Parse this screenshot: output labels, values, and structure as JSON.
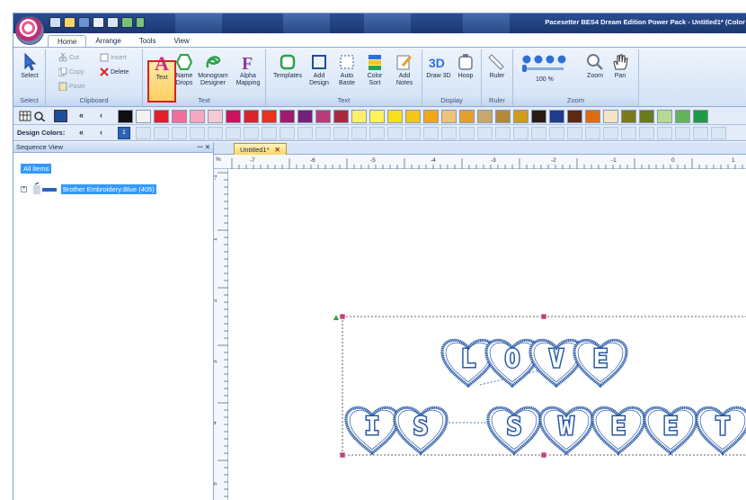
{
  "window": {
    "title": "Pacesetter BES4 Dream Edition Power Pack - Untitled1* (Color"
  },
  "ribbon_tabs": [
    {
      "label": "Home",
      "active": true
    },
    {
      "label": "Arrange",
      "active": false
    },
    {
      "label": "Tools",
      "active": false
    },
    {
      "label": "View",
      "active": false
    }
  ],
  "ribbon": {
    "select": {
      "label": "Select",
      "group": "Select"
    },
    "clipboard": {
      "cut": "Cut",
      "copy": "Copy",
      "paste": "Paste",
      "insert": "Insert",
      "delete": "Delete",
      "group": "Clipboard"
    },
    "text_group": {
      "text": "Text",
      "name_drops": "Name Drops",
      "monogram": "Monogram Designer",
      "alpha": "Alpha Mapping",
      "group": "Text"
    },
    "templates": "Templates",
    "add_design": "Add Design",
    "auto_baste": "Auto Baste",
    "color_sort": "Color Sort",
    "add_notes": "Add Notes",
    "display": {
      "draw3d": "Draw 3D",
      "hoop": "Hoop",
      "group": "Display"
    },
    "ruler": {
      "label": "Ruler",
      "group": "Ruler"
    },
    "zoom": {
      "level": "100 %",
      "zoom": "Zoom",
      "pan": "Pan",
      "group": "Zoom"
    }
  },
  "colors": {
    "palette": [
      "#101010",
      "#f2f2f2",
      "#e21e2b",
      "#ef6f9a",
      "#f5a8c1",
      "#f6c9d6",
      "#c8145a",
      "#d6262c",
      "#e8331d",
      "#9c1c6e",
      "#75217c",
      "#b63c7a",
      "#a92a3f",
      "#fdf06a",
      "#fff25a",
      "#f7e01a",
      "#f2c718",
      "#f0a818",
      "#f0c27a",
      "#e79f2d",
      "#c9a86d",
      "#b28b3a",
      "#d09c1c",
      "#2a1b12",
      "#1f3c8a",
      "#5c2a14",
      "#dd6b12",
      "#f3e4c6",
      "#7a7a1c",
      "#6b7a1b",
      "#b6d993",
      "#64b25b",
      "#1e9a48"
    ],
    "design_label": "Design Colors:",
    "design_index": "1",
    "design_swatch": "#2b63b5"
  },
  "sequence": {
    "title": "Sequence View",
    "all_items": "All items",
    "item": "Brother Embroidery:Blue (405)"
  },
  "document": {
    "tab": "Untitled1*",
    "ruler_unit": "%",
    "ruler_h": [
      "-7",
      "-6",
      "-5",
      "-4",
      "-3",
      "-2",
      "-1",
      "0",
      "1"
    ],
    "ruler_v": [
      "-1",
      "1",
      "2",
      "3",
      "4",
      "5"
    ]
  },
  "design": {
    "line1": [
      "L",
      "O",
      "V",
      "E"
    ],
    "line2a": [
      "I",
      "S"
    ],
    "line2b": [
      "S",
      "W",
      "E",
      "E",
      "T"
    ],
    "thread": "#2a5aa8"
  }
}
